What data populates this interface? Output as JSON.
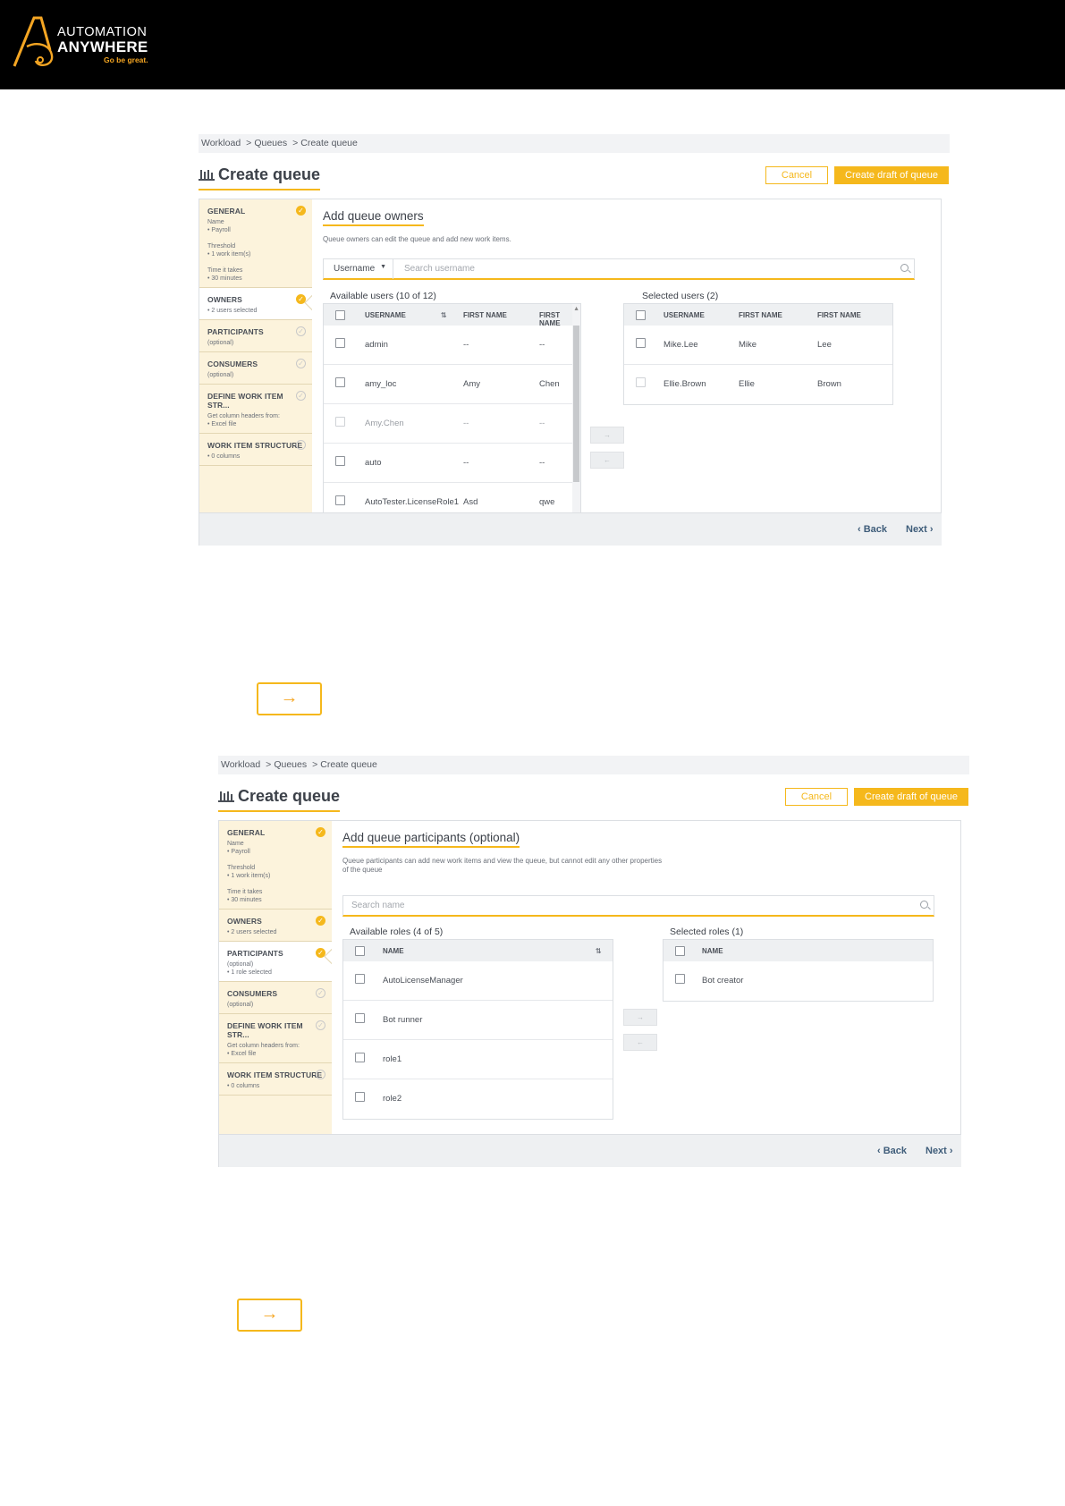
{
  "brand": {
    "line1": "AUTOMATION",
    "line2": "ANYWHERE",
    "tagline": "Go be great.",
    "colors": {
      "accent": "#f5b81c",
      "header_bg": "#000000"
    }
  },
  "screen1": {
    "breadcrumb": [
      "Workload",
      "Queues",
      "Create queue"
    ],
    "title": "Create queue",
    "cancel_label": "Cancel",
    "draft_label": "Create draft of queue",
    "steps": [
      {
        "title": "GENERAL",
        "sub": "Name\n• Payroll\n\nThreshold\n• 1 work item(s)\n\nTime it takes\n• 30 minutes",
        "done": "true"
      },
      {
        "title": "OWNERS",
        "sub": "• 2 users selected",
        "done": "true"
      },
      {
        "title": "PARTICIPANTS",
        "sub": "(optional)",
        "done": "false"
      },
      {
        "title": "CONSUMERS",
        "sub": "(optional)",
        "done": "false"
      },
      {
        "title": "DEFINE WORK ITEM STR...",
        "sub": "Get column headers from:\n• Excel file",
        "done": "false"
      },
      {
        "title": "WORK ITEM STRUCTURE",
        "sub": "• 0 columns",
        "done": "false"
      }
    ],
    "section_title": "Add queue owners",
    "section_desc": "Queue owners can edit the queue and add new work items.",
    "search": {
      "filter": "Username",
      "placeholder": "Search username"
    },
    "available_label": "Available users (10 of 12)",
    "selected_label": "Selected users (2)",
    "available_headers": [
      "USERNAME",
      "FIRST NAME",
      "FIRST NAME"
    ],
    "available_rows": [
      [
        "admin",
        "--",
        "--"
      ],
      [
        "amy_loc",
        "Amy",
        "Chen"
      ],
      [
        "Amy.Chen",
        "--",
        "--"
      ],
      [
        "auto",
        "--",
        "--"
      ],
      [
        "AutoTester.LicenseRole1",
        "Asd",
        "qwe"
      ]
    ],
    "selected_headers": [
      "USERNAME",
      "FIRST NAME",
      "FIRST NAME"
    ],
    "selected_rows": [
      [
        "Mike.Lee",
        "Mike",
        "Lee"
      ],
      [
        "Ellie.Brown",
        "Ellie",
        "Brown"
      ]
    ],
    "move_right": "→",
    "move_left": "←",
    "back_label": "‹ Back",
    "next_label": "Next ›"
  },
  "arrow1": "→",
  "screen2": {
    "breadcrumb": [
      "Workload",
      "Queues",
      "Create queue"
    ],
    "title": "Create queue",
    "cancel_label": "Cancel",
    "draft_label": "Create draft of queue",
    "steps": [
      {
        "title": "GENERAL",
        "sub": "Name\n• Payroll\n\nThreshold\n• 1 work item(s)\n\nTime it takes\n• 30 minutes",
        "done": "true"
      },
      {
        "title": "OWNERS",
        "sub": "• 2 users selected",
        "done": "true"
      },
      {
        "title": "PARTICIPANTS",
        "sub": "(optional)\n• 1 role selected",
        "done": "true"
      },
      {
        "title": "CONSUMERS",
        "sub": "(optional)",
        "done": "false"
      },
      {
        "title": "DEFINE WORK ITEM STR...",
        "sub": "Get column headers from:\n• Excel file",
        "done": "false"
      },
      {
        "title": "WORK ITEM STRUCTURE",
        "sub": "• 0 columns",
        "done": "false"
      }
    ],
    "section_title": "Add queue participants (optional)",
    "section_desc": "Queue participants can add new work items and view the queue, but cannot edit any other properties of the queue",
    "search": {
      "placeholder": "Search name"
    },
    "available_label": "Available roles (4 of 5)",
    "selected_label": "Selected roles (1)",
    "available_headers": [
      "NAME"
    ],
    "available_rows": [
      "AutoLicenseManager",
      "Bot runner",
      "role1",
      "role2"
    ],
    "selected_headers": [
      "NAME"
    ],
    "selected_rows": [
      "Bot creator"
    ],
    "move_right": "→",
    "move_left": "←",
    "back_label": "‹ Back",
    "next_label": "Next ›"
  },
  "arrow2": "→"
}
